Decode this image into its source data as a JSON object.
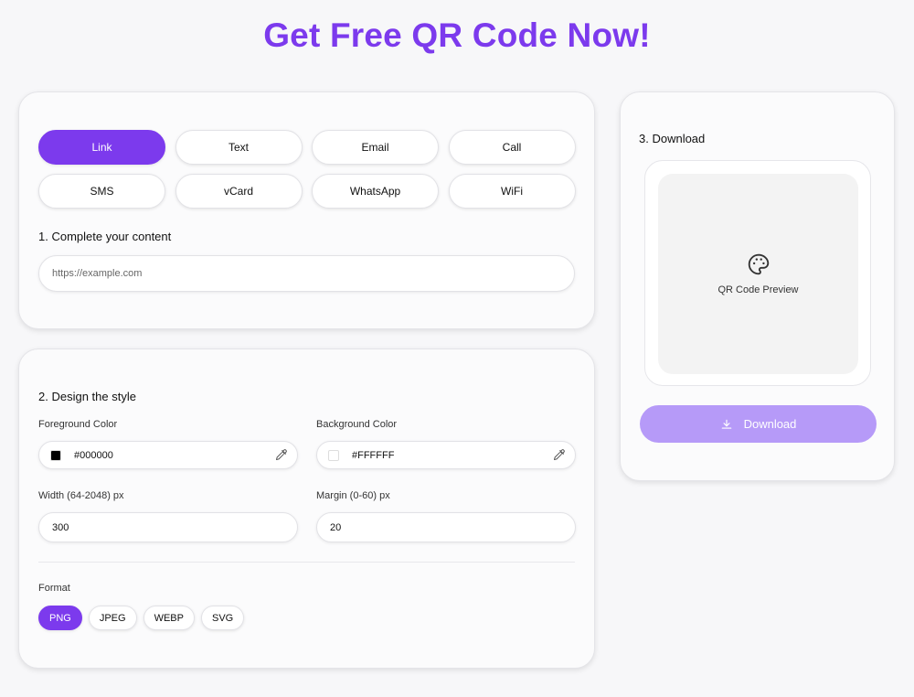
{
  "title": "Get Free QR Code Now!",
  "colors": {
    "accent": "#7c3aed",
    "download_button": "#b69af8"
  },
  "content_types": [
    {
      "label": "Link",
      "active": true
    },
    {
      "label": "Text",
      "active": false
    },
    {
      "label": "Email",
      "active": false
    },
    {
      "label": "Call",
      "active": false
    },
    {
      "label": "SMS",
      "active": false
    },
    {
      "label": "vCard",
      "active": false
    },
    {
      "label": "WhatsApp",
      "active": false
    },
    {
      "label": "WiFi",
      "active": false
    }
  ],
  "content": {
    "heading": "1. Complete your content",
    "input_placeholder": "https://example.com",
    "input_value": ""
  },
  "style": {
    "heading": "2. Design the style",
    "foreground": {
      "label": "Foreground Color",
      "value": "#000000",
      "swatch": "#000000"
    },
    "background": {
      "label": "Background Color",
      "value": "#FFFFFF",
      "swatch": "#FFFFFF"
    },
    "width": {
      "label": "Width (64-2048) px",
      "value": "300"
    },
    "margin": {
      "label": "Margin (0-60) px",
      "value": "20"
    },
    "format_label": "Format",
    "formats": [
      {
        "label": "PNG",
        "active": true
      },
      {
        "label": "JPEG",
        "active": false
      },
      {
        "label": "WEBP",
        "active": false
      },
      {
        "label": "SVG",
        "active": false
      }
    ]
  },
  "download": {
    "heading": "3. Download",
    "preview_text": "QR Code Preview",
    "button_label": "Download"
  },
  "icons": {
    "color_picker": "eyedropper-icon",
    "preview": "palette-icon",
    "download": "download-icon"
  }
}
